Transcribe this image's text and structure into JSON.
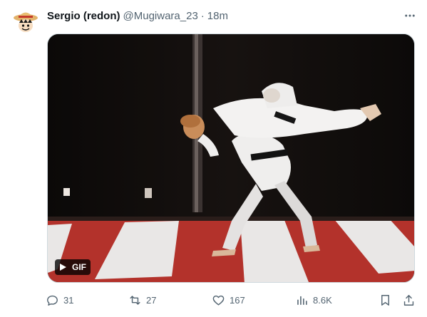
{
  "tweet": {
    "author_name": "Sergio (redon)",
    "handle": "@Mugiwara_23",
    "separator": "·",
    "time": "18m",
    "more_icon": "more-horizontal-icon",
    "media": {
      "type": "gif",
      "badge_label": "GIF",
      "badge_icon": "play-icon"
    },
    "actions": {
      "reply_count": "31",
      "retweet_count": "27",
      "like_count": "167",
      "views_count": "8.6K"
    }
  },
  "colors": {
    "text_primary": "#0f1419",
    "text_secondary": "#536471",
    "border": "#cfd9de",
    "mat_red": "#b3322b",
    "mat_white": "#e9e7e6"
  }
}
